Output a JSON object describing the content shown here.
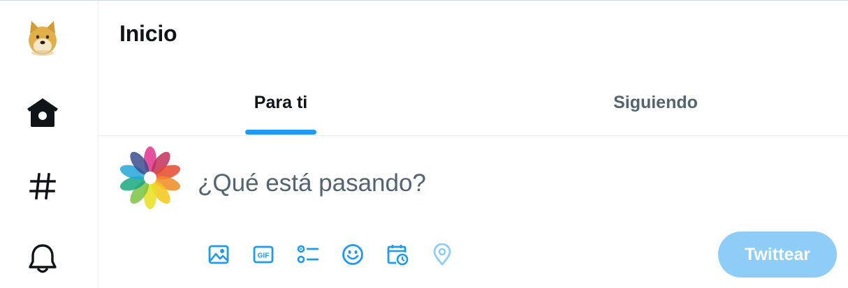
{
  "nav": {
    "logo_icon": "doge-avatar-icon",
    "home_icon": "home-icon",
    "explore_icon": "hashtag-icon",
    "notifications_icon": "bell-icon"
  },
  "header": {
    "title": "Inicio"
  },
  "tabs": [
    {
      "label": "Para ti",
      "active": true
    },
    {
      "label": "Siguiendo",
      "active": false
    }
  ],
  "composer": {
    "placeholder": "¿Qué está pasando?",
    "avatar_icon": "colorful-flower-avatar-icon",
    "tools": [
      "image-icon",
      "gif-icon",
      "poll-icon",
      "emoji-icon",
      "schedule-icon",
      "location-icon"
    ],
    "tweet_label": "Twittear"
  },
  "colors": {
    "accent": "#1d9bf0",
    "tweet_button_disabled": "#8ecdf8",
    "secondary_text": "#536471"
  }
}
